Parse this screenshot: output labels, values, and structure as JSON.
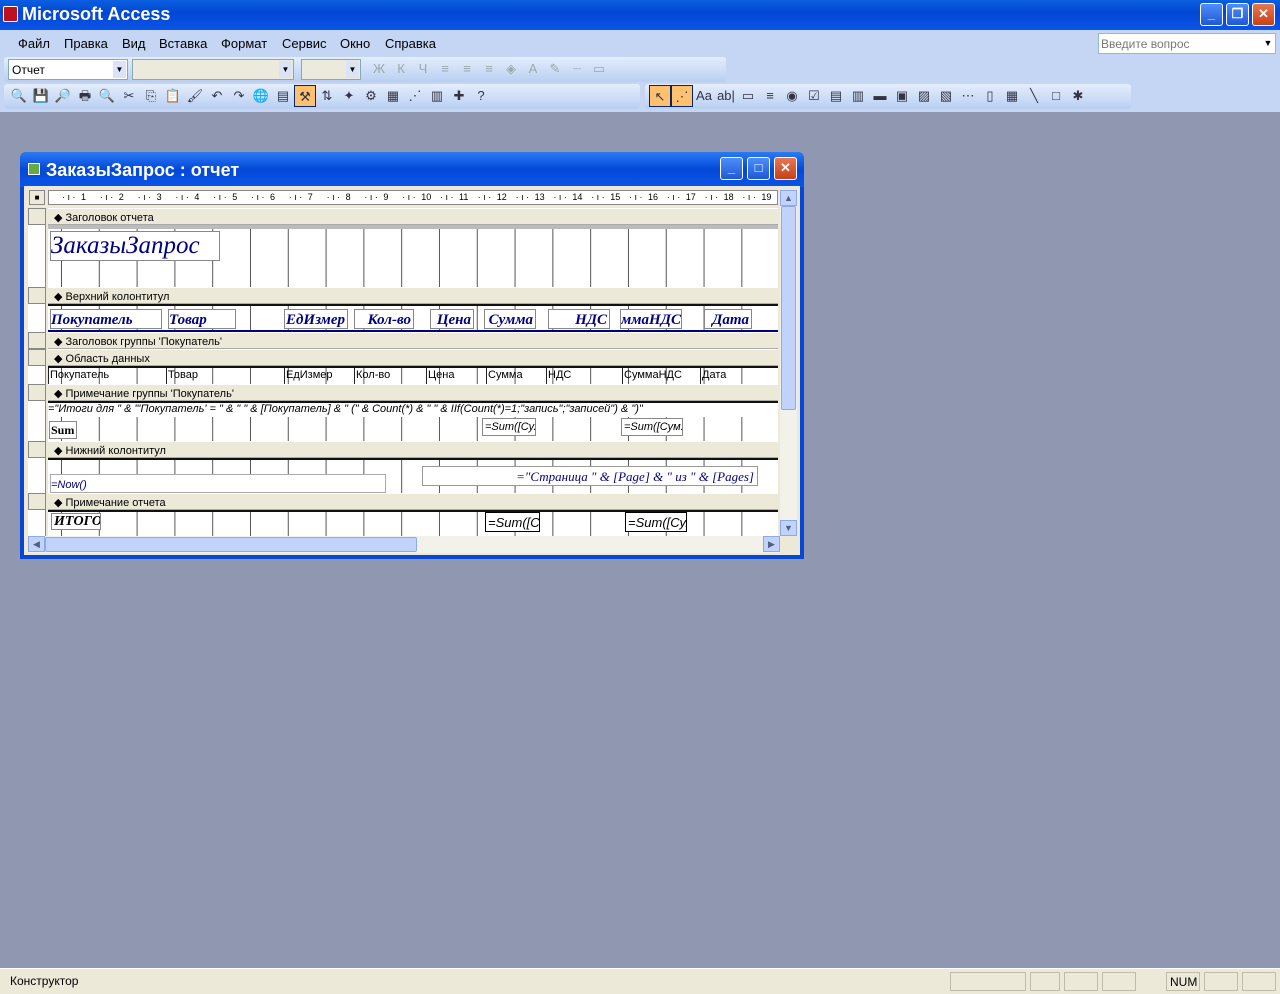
{
  "app": {
    "title": "Microsoft Access"
  },
  "menu": [
    "Файл",
    "Правка",
    "Вид",
    "Вставка",
    "Формат",
    "Сервис",
    "Окно",
    "Справка"
  ],
  "help_placeholder": "Введите вопрос",
  "format_toolbar": {
    "object": "Отчет",
    "font": "",
    "size": "",
    "icons": [
      "bold-icon",
      "italic-icon",
      "underline-icon",
      "align-left-icon",
      "align-center-icon",
      "align-right-icon",
      "fill-color-icon",
      "font-color-icon",
      "line-color-icon",
      "border-style-icon",
      "line-width-icon"
    ],
    "glyphs": [
      "Ж",
      "К",
      "Ч",
      "≡",
      "≡",
      "≡",
      "◈",
      "A",
      "✎",
      "┈",
      "▭"
    ]
  },
  "design_toolbar": {
    "icons": [
      "view-icon",
      "save-icon",
      "file-search-icon",
      "print-icon",
      "print-preview-icon",
      "cut-icon",
      "copy-icon",
      "paste-icon",
      "format-painter-icon",
      "undo-icon",
      "redo-icon",
      "hyperlink-icon",
      "field-list-icon",
      "toolbox-icon",
      "sorting-grouping-icon",
      "autoformat-icon",
      "code-icon",
      "properties-icon",
      "build-icon",
      "database-window-icon",
      "new-object-icon",
      "help-icon"
    ],
    "glyphs": [
      "🔍",
      "💾",
      "🔎",
      "🖶",
      "🔍",
      "✂",
      "⎘",
      "📋",
      "🖌",
      "↶",
      "↷",
      "🌐",
      "▤",
      "⚒",
      "⇅",
      "✦",
      "⚙",
      "▦",
      "⋰",
      "▥",
      "✚",
      "?"
    ]
  },
  "toolbox": {
    "icons": [
      "select-objects-icon",
      "control-wizards-icon",
      "label-icon",
      "textbox-icon",
      "option-group-icon",
      "toggle-button-icon",
      "option-button-icon",
      "checkbox-icon",
      "combobox-icon",
      "listbox-icon",
      "command-button-icon",
      "image-icon",
      "unbound-object-icon",
      "bound-object-icon",
      "page-break-icon",
      "tab-control-icon",
      "subreport-icon",
      "line-icon",
      "rectangle-icon",
      "more-controls-icon"
    ],
    "glyphs": [
      "↖",
      "⋰",
      "Aa",
      "ab|",
      "▭",
      "≡",
      "◉",
      "☑",
      "▤",
      "▥",
      "▬",
      "▣",
      "▨",
      "▧",
      "⋯",
      "▯",
      "▦",
      "╲",
      "□",
      "✱"
    ]
  },
  "report_window": {
    "title": "ЗаказыЗапрос : отчет"
  },
  "ruler": [
    "1",
    "2",
    "3",
    "4",
    "5",
    "6",
    "7",
    "8",
    "9",
    "10",
    "11",
    "12",
    "13",
    "14",
    "15",
    "16",
    "17",
    "18",
    "19"
  ],
  "sections": {
    "report_header": "Заголовок отчета",
    "page_header": "Верхний колонтитул",
    "group_header": "Заголовок группы 'Покупатель'",
    "detail": "Область данных",
    "group_footer": "Примечание группы 'Покупатель'",
    "page_footer": "Нижний колонтитул",
    "report_footer": "Примечание отчета"
  },
  "report_header": {
    "title": "ЗаказыЗапрос"
  },
  "page_header": {
    "labels": [
      "Покупатель",
      "Товар",
      "ЕдИзмер",
      "Кол-во",
      "Цена",
      "Сумма",
      "НДС",
      "ммаНДС",
      "Дата"
    ]
  },
  "detail": {
    "fields": [
      "Покупатель",
      "Товар",
      "ЕдИзмер",
      "Кол-во",
      "Цена",
      "Сумма",
      "НДС",
      "СуммаНДС",
      "Дата"
    ]
  },
  "group_footer": {
    "expr": "=\"Итоги для \" & \"'Покупатель' = \" & \" \" & [Покупатель] & \" (\" & Count(*) & \" \" & IIf(Count(*)=1;\"запись\";\"записей\") & \")\"",
    "sum_label": "Sum",
    "sum1": "=Sum([Су.",
    "sum2": "=Sum([Сум."
  },
  "page_footer": {
    "now": "=Now()",
    "page": "=\"Страница \" & [Page] & \" из \" & [Pages]"
  },
  "report_footer": {
    "label": "ИТОГО",
    "sum1": "=Sum([С",
    "sum2": "=Sum([Су."
  },
  "status": {
    "text": "Конструктор",
    "num": "NUM"
  }
}
